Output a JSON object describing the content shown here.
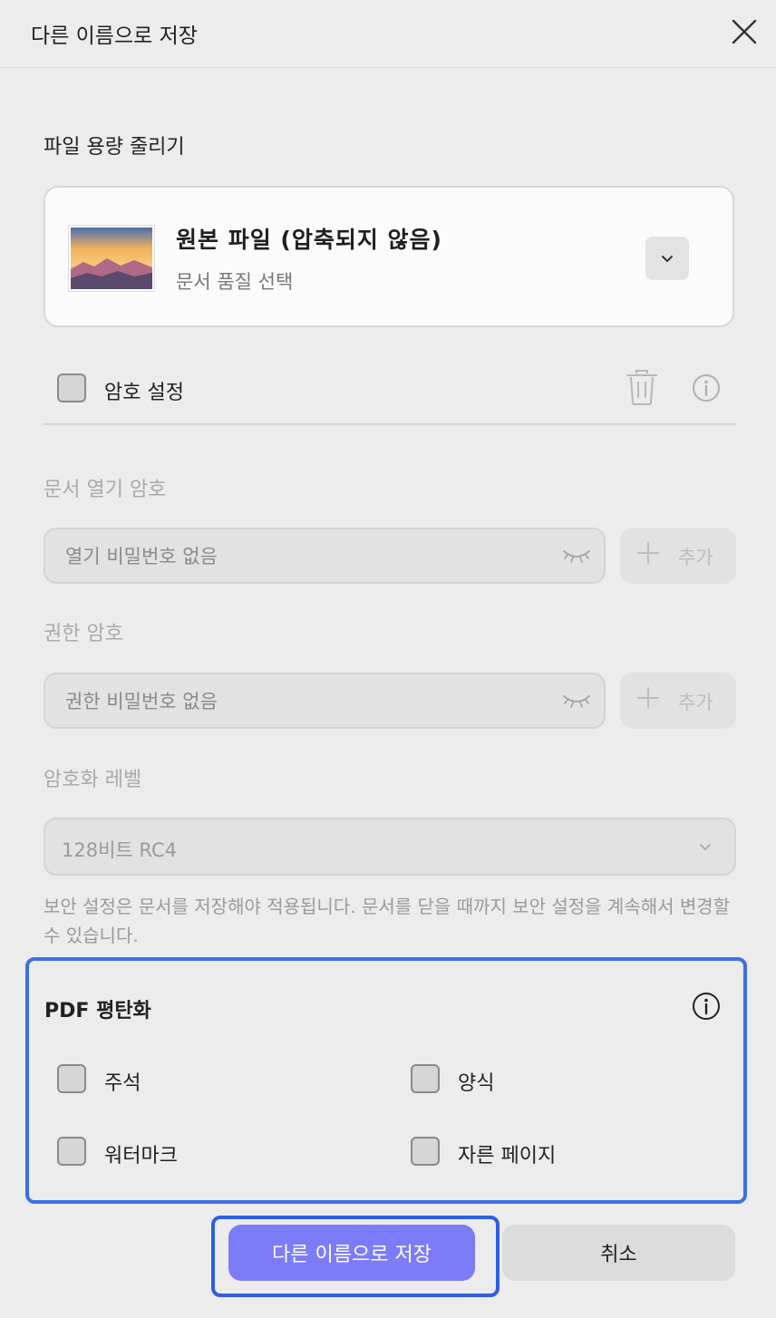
{
  "dialog": {
    "title": "다른 이름으로 저장"
  },
  "compress": {
    "heading": "파일 용량 줄리기",
    "option_title": "원본 파일 (압축되지 않음)",
    "option_subtitle": "문서 품질 선택"
  },
  "password": {
    "checkbox_label": "암호 설정",
    "open_heading": "문서 열기 암호",
    "open_placeholder": "열기 비밀번호 없음",
    "perm_heading": "권한 암호",
    "perm_placeholder": "권한 비밀번호 없음",
    "add_label": "추가",
    "level_heading": "암호화 레벨",
    "level_value": "128비트 RC4",
    "note": "보안 설정은 문서를 저장해야 적용됩니다. 문서를 닫을 때까지 보안 설정을 계속해서 변경할 수 있습니다."
  },
  "flatten": {
    "heading": "PDF 평탄화",
    "options": [
      "주석",
      "양식",
      "워터마크",
      "자른 페이지"
    ]
  },
  "actions": {
    "save_label": "다른 이름으로 저장",
    "cancel_label": "취소"
  },
  "colors": {
    "accent": "#7c7cf8",
    "highlight": "#3c6fe6",
    "background": "#ececec"
  }
}
